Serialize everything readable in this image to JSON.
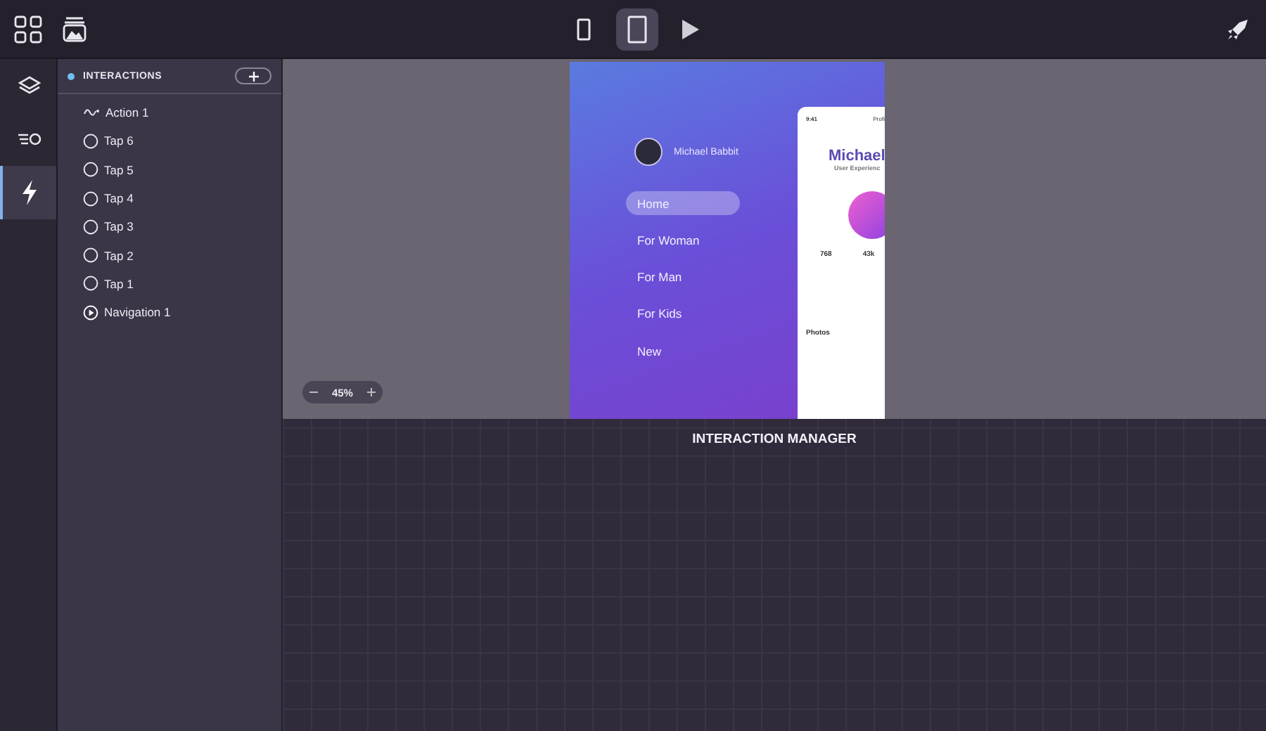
{
  "toolbar": {
    "devices": [
      {
        "kind": "phone",
        "selected": false
      },
      {
        "kind": "tablet",
        "selected": true
      },
      {
        "kind": "play",
        "selected": false
      }
    ]
  },
  "rail": [
    {
      "kind": "layers",
      "selected": false
    },
    {
      "kind": "list",
      "selected": false
    },
    {
      "kind": "bolt",
      "selected": true
    }
  ],
  "panel": {
    "title": "INTERACTIONS",
    "items": [
      {
        "kind": "action",
        "label": "Action 1"
      },
      {
        "kind": "tap",
        "label": "Tap 6"
      },
      {
        "kind": "tap",
        "label": "Tap 5"
      },
      {
        "kind": "tap",
        "label": "Tap 4"
      },
      {
        "kind": "tap",
        "label": "Tap 3"
      },
      {
        "kind": "tap",
        "label": "Tap 2"
      },
      {
        "kind": "tap",
        "label": "Tap 1"
      },
      {
        "kind": "navigation",
        "label": "Navigation 1"
      }
    ]
  },
  "preview": {
    "user": "Michael Babbit",
    "menu": [
      {
        "label": "Home",
        "selected": true
      },
      {
        "label": "For Woman",
        "selected": false
      },
      {
        "label": "For Man",
        "selected": false
      },
      {
        "label": "For Kids",
        "selected": false
      },
      {
        "label": "New",
        "selected": false
      }
    ],
    "card": {
      "time": "9:41",
      "title": "Profi",
      "name": "Michael",
      "role": "User Experienc",
      "stats": [
        "768",
        "43k"
      ],
      "section": "Photos"
    }
  },
  "zoom": {
    "value": "45%"
  },
  "manager": {
    "title": "INTERACTION MANAGER"
  }
}
